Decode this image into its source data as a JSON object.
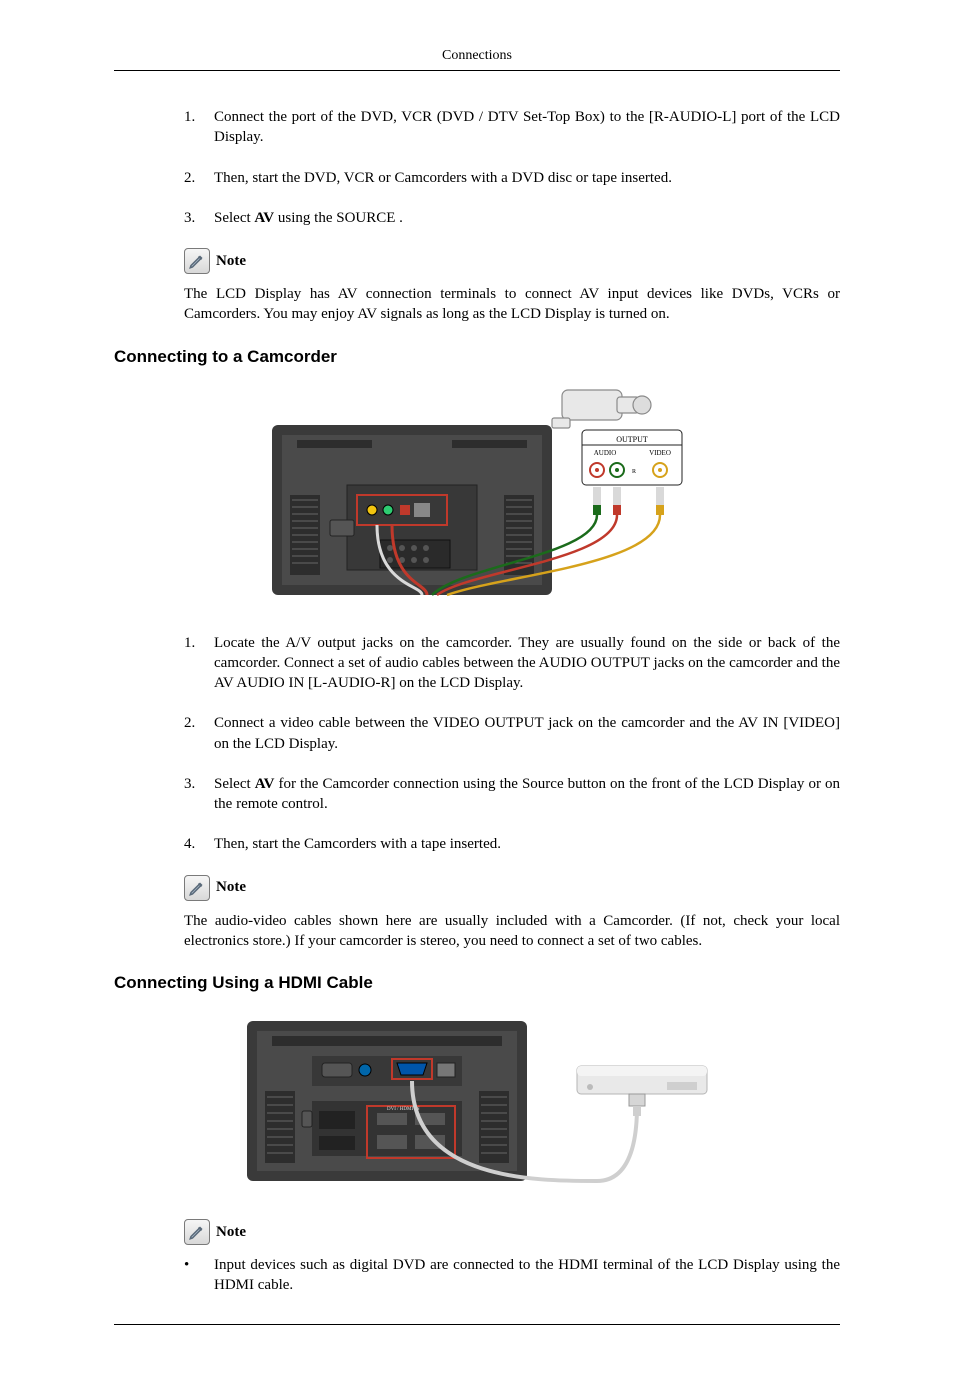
{
  "header": {
    "running_title": "Connections"
  },
  "section_dvd": {
    "steps": [
      "Connect the port of the DVD, VCR (DVD / DTV Set-Top Box) to the [R-AUDIO-L] port of the LCD Display.",
      "Then, start the DVD, VCR or Camcorders with a DVD disc or tape inserted.",
      "Select AV using the SOURCE ."
    ],
    "step3_prefix": "Select ",
    "step3_bold": "AV",
    "step3_suffix": " using the SOURCE .",
    "note_label": "Note",
    "note_text": "The LCD Display has AV connection terminals to connect AV input devices like DVDs, VCRs or Camcorders. You may enjoy AV signals as long as the LCD Display is turned on."
  },
  "section_camcorder": {
    "title": "Connecting to a Camcorder",
    "figure": {
      "labels": {
        "box_title": "OUTPUT",
        "box_audio": "AUDIO",
        "box_video": "VIDEO"
      }
    },
    "steps_plain": {
      "s1": "Locate the A/V output jacks on the camcorder. They are usually found on the side or back of the camcorder. Connect a set of audio cables between the AUDIO OUTPUT jacks on the camcorder and the AV AUDIO IN [L-AUDIO-R] on the LCD Display.",
      "s2": "Connect a video cable between the VIDEO OUTPUT jack on the camcorder and the AV IN [VIDEO] on the LCD Display.",
      "s3_prefix": "Select ",
      "s3_bold": "AV",
      "s3_suffix": " for the Camcorder connection using the Source button on the front of the LCD Display or on the remote control.",
      "s4": "Then, start the Camcorders with a tape inserted."
    },
    "note_label": "Note",
    "note_text": "The audio-video cables shown here are usually included with a Camcorder. (If not, check your local electronics store.) If your camcorder is stereo, you need to connect a set of two cables."
  },
  "section_hdmi": {
    "title": "Connecting Using a HDMI Cable",
    "note_label": "Note",
    "bullets": [
      "Input devices such as digital DVD are connected to the HDMI terminal of the LCD Display using the HDMI cable."
    ]
  }
}
